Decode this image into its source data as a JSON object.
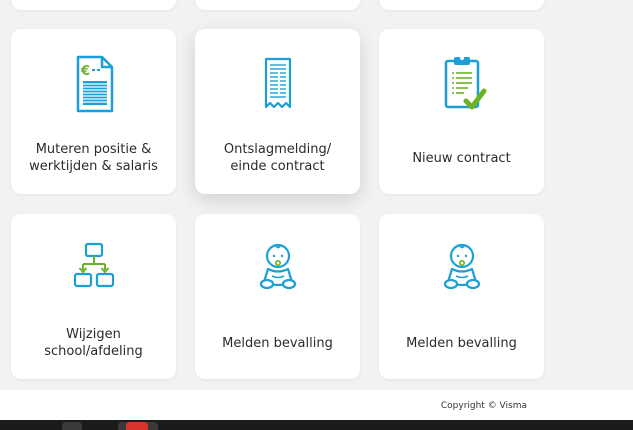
{
  "tiles_row0": [
    {
      "id": "top-tile-1"
    },
    {
      "id": "top-tile-2"
    },
    {
      "id": "top-tile-3"
    }
  ],
  "tiles": [
    {
      "label": "Muteren positie &\nwerktijden & salaris",
      "icon": "salary-document-icon"
    },
    {
      "label": "Ontslagmelding/\neinde contract",
      "icon": "receipt-icon"
    },
    {
      "label": "Nieuw contract",
      "icon": "clipboard-check-icon"
    },
    {
      "label": "Wijzigen\nschool/afdeling",
      "icon": "org-chart-icon"
    },
    {
      "label": "Melden bevalling",
      "icon": "baby-icon"
    },
    {
      "label": "Melden bevalling",
      "icon": "baby-icon"
    }
  ],
  "footer": {
    "copyright": "Copyright © Visma"
  },
  "colors": {
    "accent_blue": "#1a9fd6",
    "accent_green": "#6bb324",
    "background": "#f2f2f2",
    "tile": "#ffffff"
  }
}
